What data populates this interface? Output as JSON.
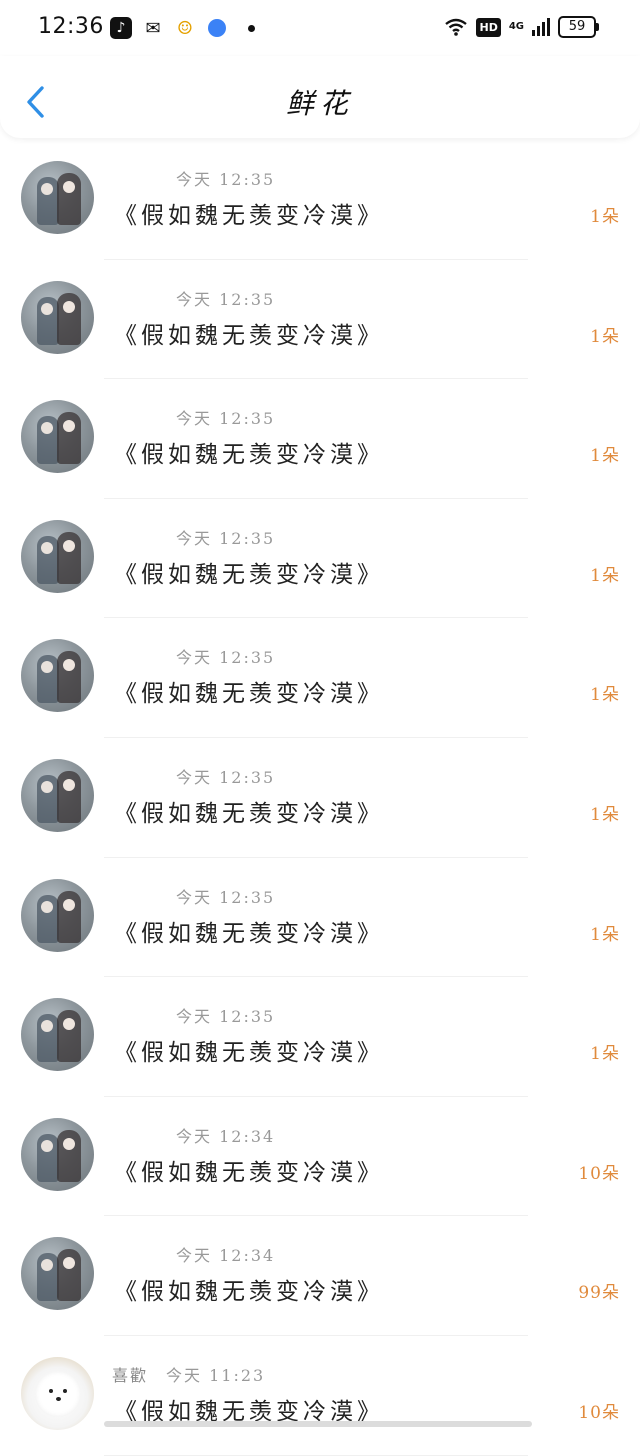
{
  "status_bar": {
    "time": "12:36",
    "battery": "59",
    "network": "4G",
    "hd": "HD"
  },
  "nav": {
    "title": "鲜花"
  },
  "colors": {
    "accent_back": "#2f8fe6",
    "amount": "#e08a3c",
    "meta": "#999999"
  },
  "rows": [
    {
      "name": "",
      "time": "今天 12:35",
      "title": "《假如魏无羡变冷漠》",
      "amount": "1朵",
      "avatar": "anime"
    },
    {
      "name": "",
      "time": "今天 12:35",
      "title": "《假如魏无羡变冷漠》",
      "amount": "1朵",
      "avatar": "anime"
    },
    {
      "name": "",
      "time": "今天 12:35",
      "title": "《假如魏无羡变冷漠》",
      "amount": "1朵",
      "avatar": "anime"
    },
    {
      "name": "",
      "time": "今天 12:35",
      "title": "《假如魏无羡变冷漠》",
      "amount": "1朵",
      "avatar": "anime"
    },
    {
      "name": "",
      "time": "今天 12:35",
      "title": "《假如魏无羡变冷漠》",
      "amount": "1朵",
      "avatar": "anime"
    },
    {
      "name": "",
      "time": "今天 12:35",
      "title": "《假如魏无羡变冷漠》",
      "amount": "1朵",
      "avatar": "anime"
    },
    {
      "name": "",
      "time": "今天 12:35",
      "title": "《假如魏无羡变冷漠》",
      "amount": "1朵",
      "avatar": "anime"
    },
    {
      "name": "",
      "time": "今天 12:35",
      "title": "《假如魏无羡变冷漠》",
      "amount": "1朵",
      "avatar": "anime"
    },
    {
      "name": "",
      "time": "今天 12:34",
      "title": "《假如魏无羡变冷漠》",
      "amount": "10朵",
      "avatar": "anime"
    },
    {
      "name": "",
      "time": "今天 12:34",
      "title": "《假如魏无羡变冷漠》",
      "amount": "99朵",
      "avatar": "anime"
    },
    {
      "name": "喜歡",
      "time": "今天 11:23",
      "title": "《假如魏无羡变冷漠》",
      "amount": "10朵",
      "avatar": "dog"
    }
  ]
}
